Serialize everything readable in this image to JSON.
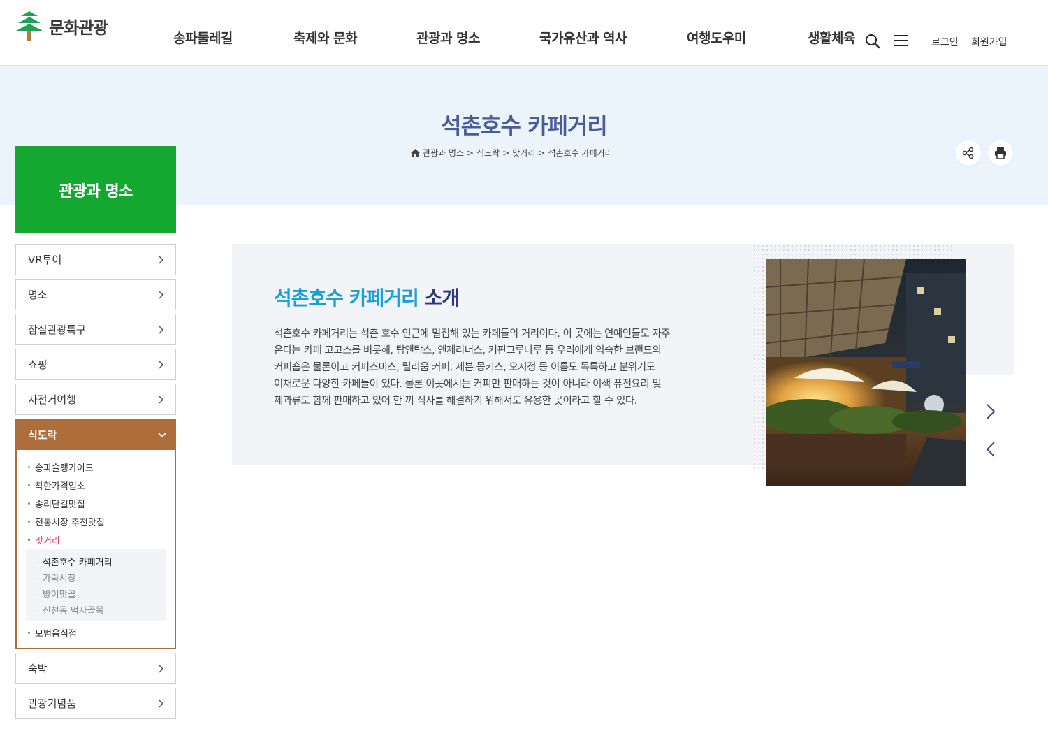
{
  "header": {
    "logo_text": "문화관광",
    "nav": [
      "송파둘레길",
      "축제와 문화",
      "관광과 명소",
      "국가유산과 역사",
      "여행도우미",
      "생활체육"
    ],
    "login": "로그인",
    "signup": "회원가입"
  },
  "page": {
    "title": "석촌호수 카페거리",
    "breadcrumb": [
      "관광과 명소",
      "식도락",
      "맛거리",
      "석촌호수 카페거리"
    ]
  },
  "sidebar": {
    "title": "관광과 명소",
    "items_top": [
      "VR투어",
      "명소",
      "잠실관광특구",
      "쇼핑",
      "자전거여행"
    ],
    "active": "식도락",
    "sub_items": [
      "송파슐랭가이드",
      "착한가격업소",
      "송리단길맛집",
      "전통시장 추천맛집",
      "맛거리"
    ],
    "sub_current_index": 4,
    "third_items": [
      "석촌호수 카페거리",
      "가락시장",
      "방이맛골",
      "신천동 먹자골목"
    ],
    "third_current_index": 0,
    "sub_last": "모범음식점",
    "items_bottom": [
      "숙박",
      "관광기념품"
    ]
  },
  "content": {
    "heading_highlight": "석촌호수 카페거리",
    "heading_rest": " 소개",
    "lines": [
      "석촌호수 카페거리는 석촌 호수 인근에 밀집해 있는 카페들의 거리이다. 이 곳에는 연예인들도 자주",
      "온다는 카페 고고스를 비롯해, 탐앤탐스, 엔제리너스, 커핀그루나루 등 우리에게 익숙한 브랜드의",
      "커피숍은 물론이고 커피스미스, 릴리움 커피, 세븐 몽키스, 오시정 등 이름도 독특하고 분위기도",
      "이채로운 다양한 카페들이 있다. 물론 이곳에서는 커피만 판매하는 것이 아니라 이색 퓨전요리 및",
      "제과류도 함께 판매하고 있어 한 끼 식사를 해결하기 위해서도 유용한 곳이라고 할 수 있다."
    ]
  },
  "colors": {
    "green": "#14a830",
    "brown": "#ad6e3c",
    "title_blue": "#4a5a9a",
    "heading_cyan": "#1a9fd6"
  }
}
